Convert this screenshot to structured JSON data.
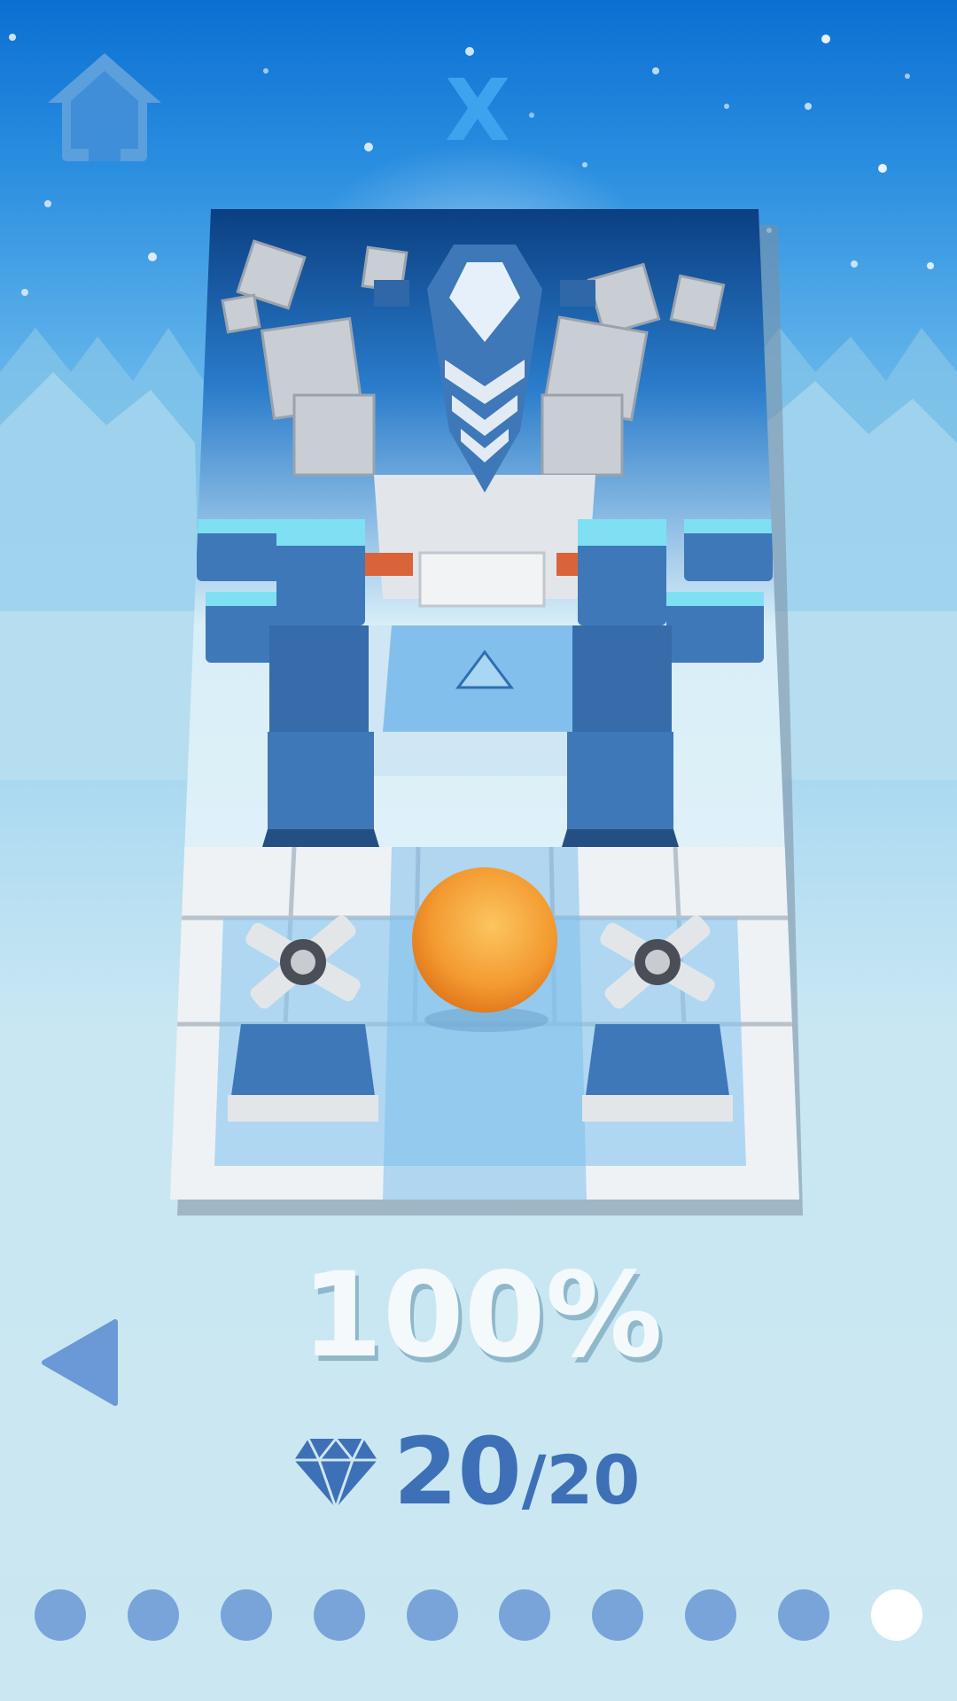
{
  "header": {
    "home_icon": "home-icon",
    "title": "X"
  },
  "level_card": {
    "scene": "ice-fortress-level-preview",
    "ball_color": "#f09a2e",
    "theme_color": "#3e78b8"
  },
  "progress": {
    "percent_label": "100%"
  },
  "gems": {
    "icon": "diamond-icon",
    "collected": "20",
    "total": "/20"
  },
  "navigation": {
    "prev_icon": "triangle-left-icon",
    "pages": 10,
    "active_page": 10
  },
  "colors": {
    "accent": "#3ea3ee",
    "dot": "#78a4d9",
    "dot_active": "#ffffff",
    "gem": "#3e70b7"
  }
}
